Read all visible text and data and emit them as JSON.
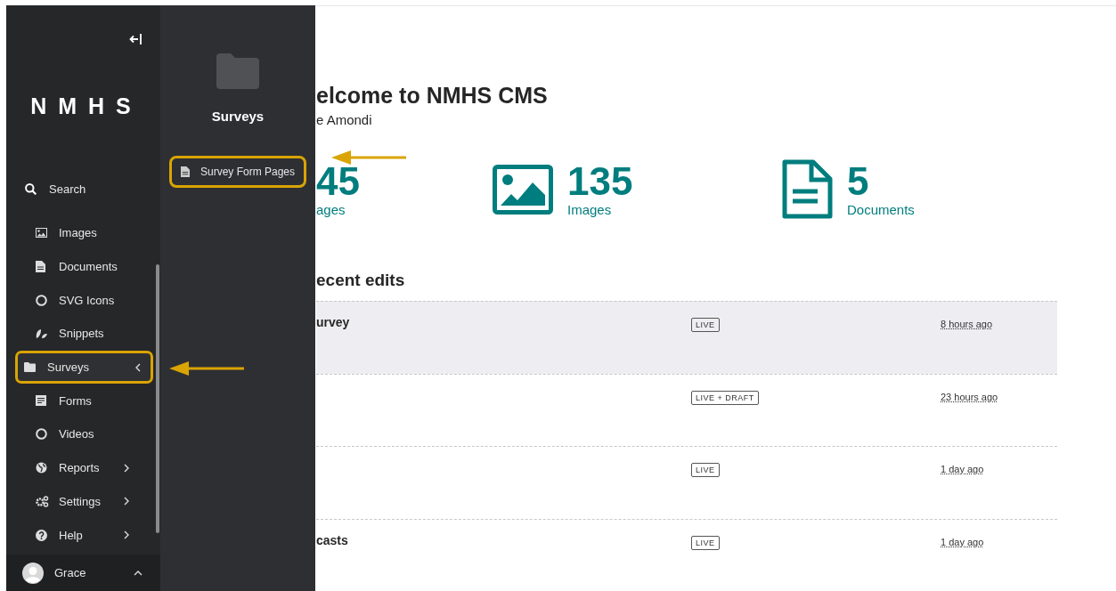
{
  "sidebar": {
    "logo": "N M H S",
    "search": {
      "label": "Search"
    },
    "items": [
      {
        "label": "Images",
        "kind": "link"
      },
      {
        "label": "Documents",
        "kind": "link"
      },
      {
        "label": "SVG Icons",
        "kind": "link"
      },
      {
        "label": "Snippets",
        "kind": "link"
      },
      {
        "label": "Surveys",
        "kind": "submenu",
        "expanded": true,
        "highlighted": true
      },
      {
        "label": "Forms",
        "kind": "link"
      },
      {
        "label": "Videos",
        "kind": "link"
      },
      {
        "label": "Reports",
        "kind": "submenu",
        "expanded": false,
        "highlighted": false
      },
      {
        "label": "Settings",
        "kind": "submenu",
        "expanded": false,
        "highlighted": false
      },
      {
        "label": "Help",
        "kind": "submenu",
        "expanded": false,
        "highlighted": false
      }
    ],
    "user": {
      "name": "Grace"
    }
  },
  "submenu": {
    "title": "Surveys",
    "items": [
      {
        "label": "Survey Form Pages",
        "highlighted": true
      }
    ]
  },
  "main": {
    "title": "elcome to NMHS CMS",
    "subtitle": "e Amondi",
    "stats": [
      {
        "value": "45",
        "label": "ages"
      },
      {
        "value": "135",
        "label": "Images"
      },
      {
        "value": "5",
        "label": "Documents"
      }
    ],
    "recent_title": "ecent edits",
    "rows": [
      {
        "title": "urvey",
        "status": "LIVE",
        "time": "8 hours ago",
        "highlighted": true
      },
      {
        "status": "LIVE + DRAFT",
        "time": "23 hours ago",
        "highlighted": false
      },
      {
        "status": "LIVE",
        "time": "1 day ago",
        "highlighted": false
      },
      {
        "title": "casts",
        "status": "LIVE",
        "time": "1 day ago",
        "highlighted": false
      }
    ]
  }
}
